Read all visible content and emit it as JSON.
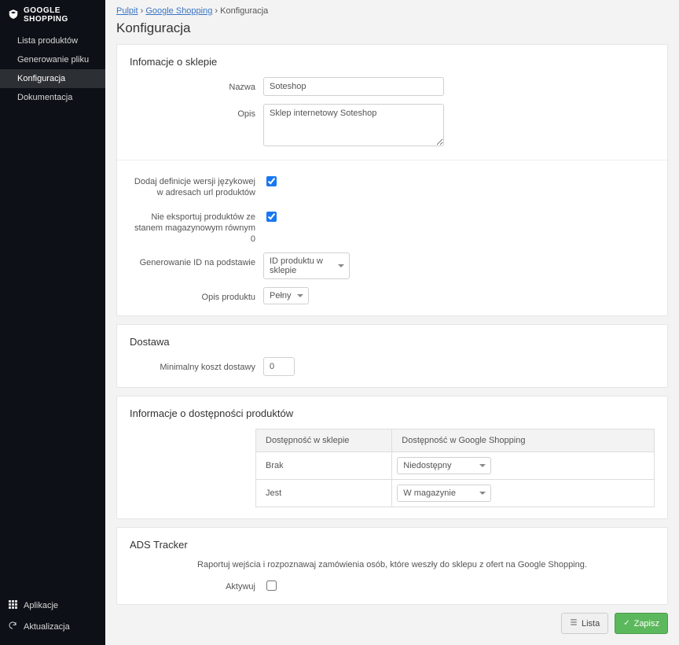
{
  "brand": "GOOGLE SHOPPING",
  "nav": {
    "items": [
      {
        "label": "Lista produktów"
      },
      {
        "label": "Generowanie pliku"
      },
      {
        "label": "Konfiguracja"
      },
      {
        "label": "Dokumentacja"
      }
    ],
    "active_index": 2
  },
  "sidebar_footer": {
    "apps": "Aplikacje",
    "update": "Aktualizacja"
  },
  "crumbs": {
    "a": "Pulpit",
    "b": "Google Shopping",
    "c": "Konfiguracja"
  },
  "page_title": "Konfiguracja",
  "sections": {
    "store_info": {
      "title": "Infomacje o sklepie",
      "name_label": "Nazwa",
      "name_value": "Soteshop",
      "desc_label": "Opis",
      "desc_value": "Sklep internetowy Soteshop",
      "lang_label": "Dodaj definicje wersji językowej w adresach url produktów",
      "lang_checked": true,
      "stock_label": "Nie eksportuj produktów ze stanem magazynowym równym 0",
      "stock_checked": true,
      "idgen_label": "Generowanie ID na podstawie",
      "idgen_value": "ID produktu w sklepie",
      "pdesc_label": "Opis produktu",
      "pdesc_value": "Pełny"
    },
    "delivery": {
      "title": "Dostawa",
      "min_label": "Minimalny koszt dostawy",
      "min_value": "0"
    },
    "availability": {
      "title": "Informacje o dostępności produktów",
      "col_store": "Dostępność w sklepie",
      "col_google": "Dostępność w Google Shopping",
      "rows": [
        {
          "label": "Brak",
          "value": "Niedostępny"
        },
        {
          "label": "Jest",
          "value": "W magazynie"
        }
      ]
    },
    "ads": {
      "title": "ADS Tracker",
      "note": "Raportuj wejścia i rozpoznawaj zamówienia osób, które weszły do sklepu z ofert na Google Shopping.",
      "activate_label": "Aktywuj",
      "activate_checked": false
    }
  },
  "footer": {
    "list": "Lista",
    "save": "Zapisz"
  }
}
